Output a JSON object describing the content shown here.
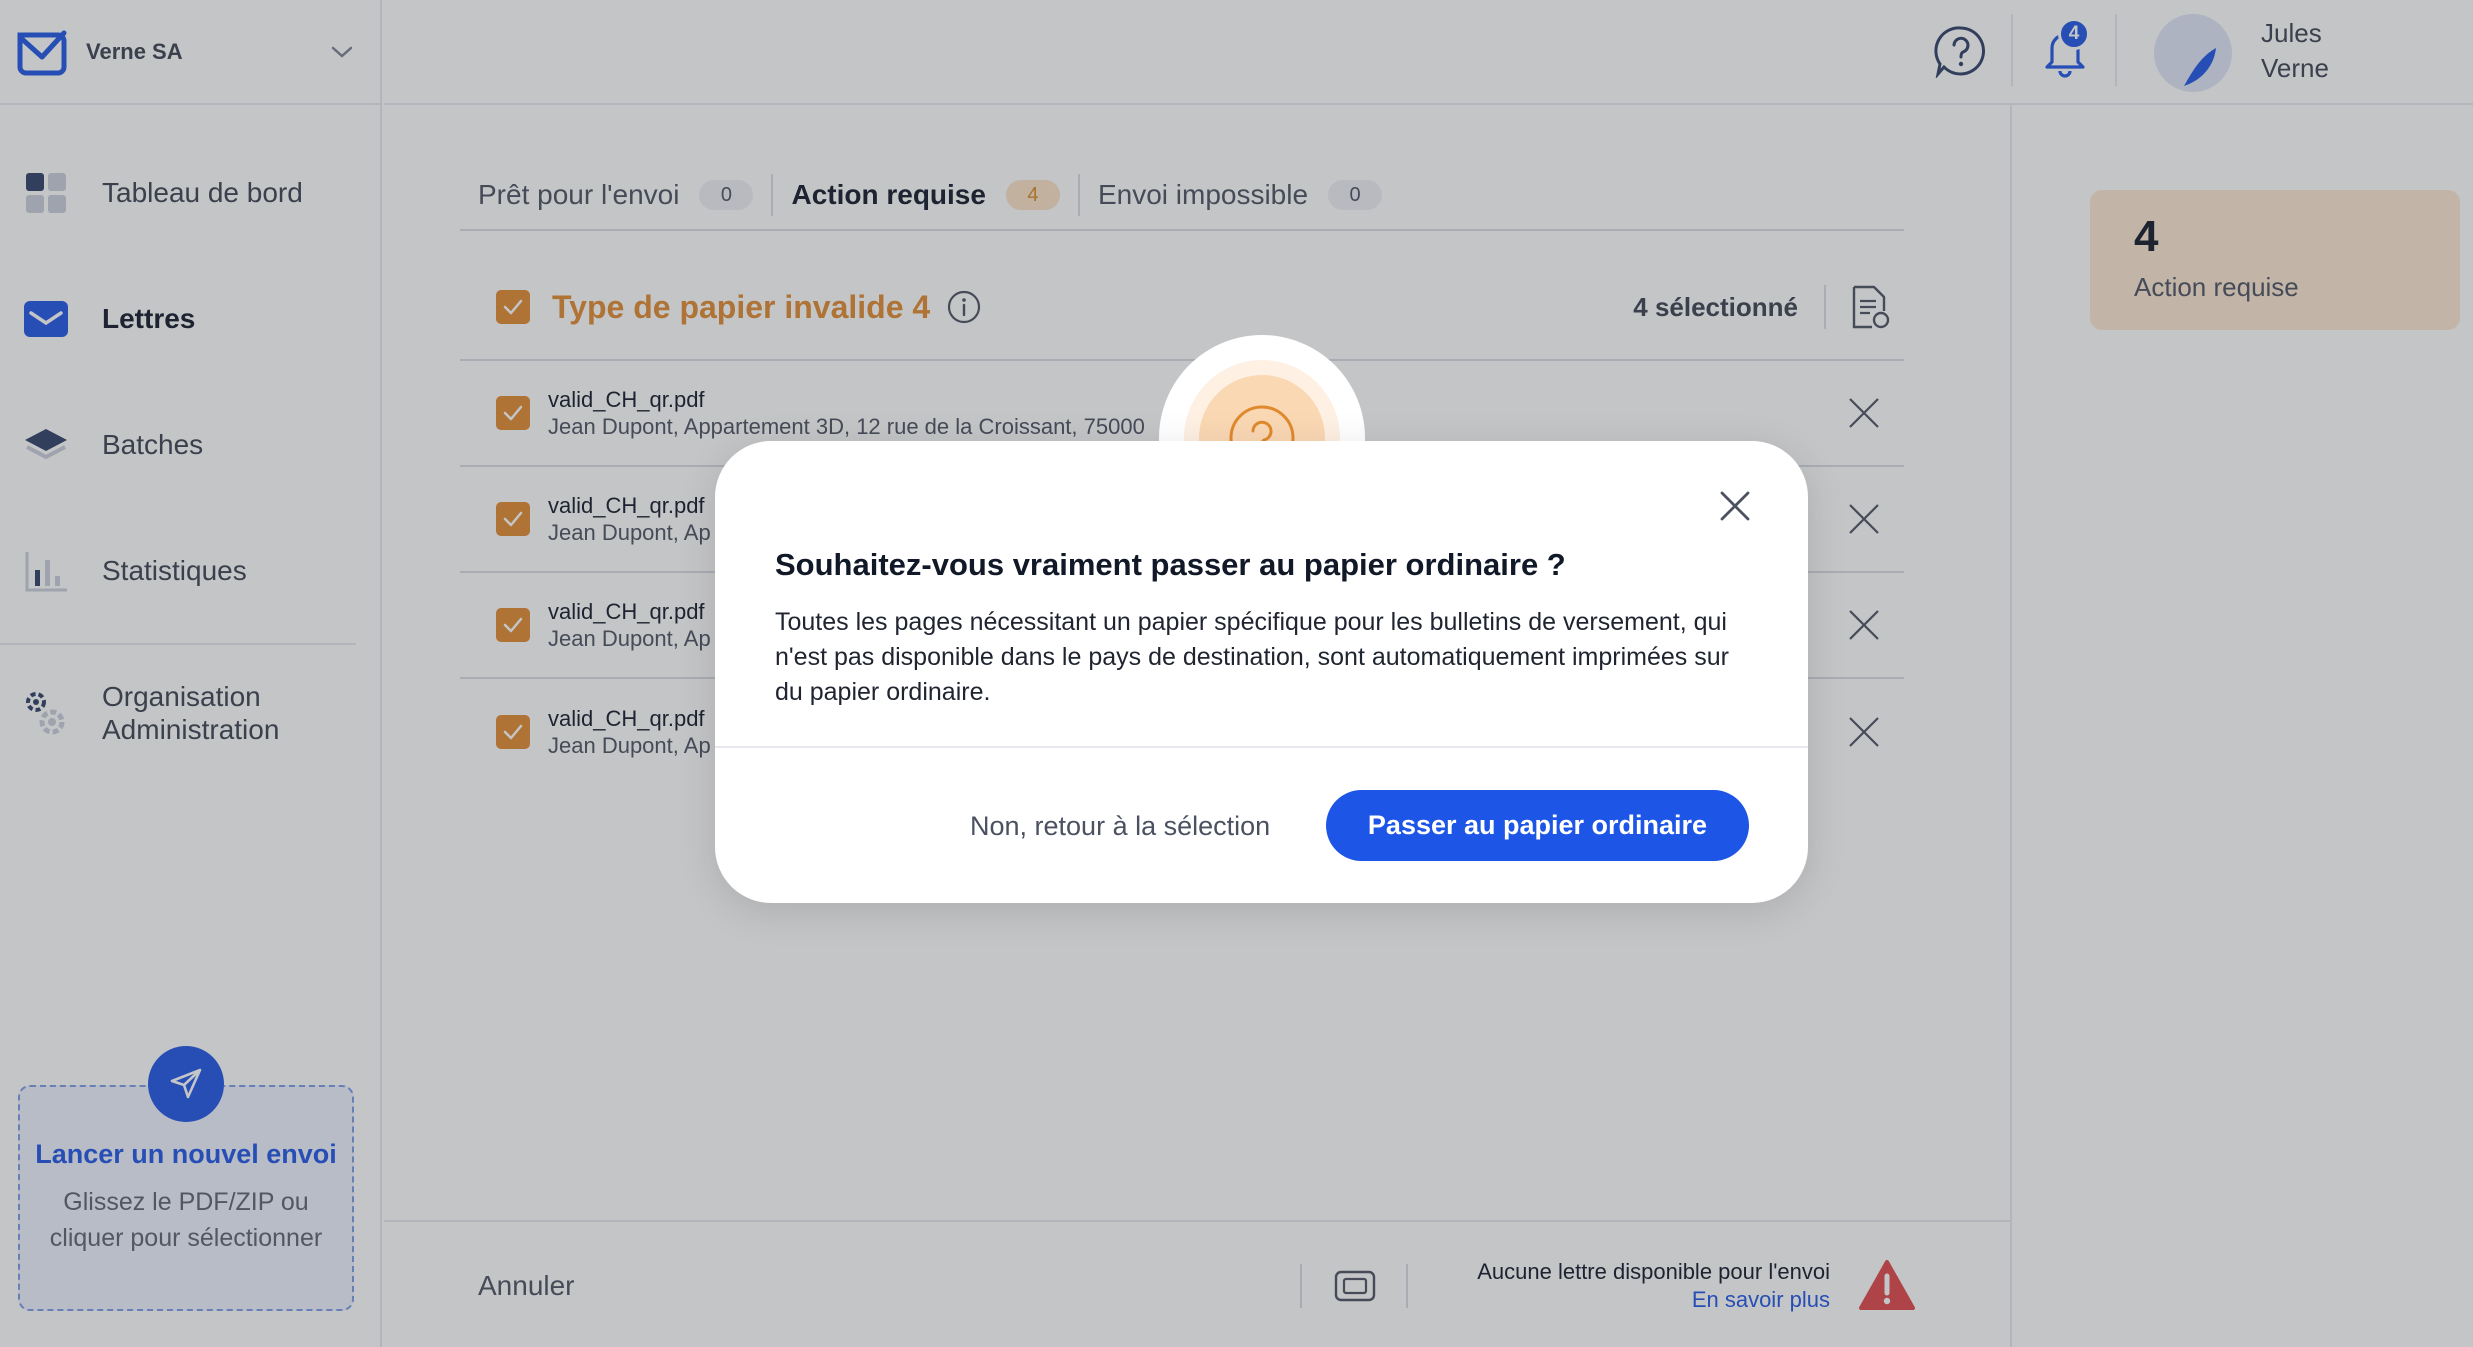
{
  "sidebar": {
    "org_name": "Verne SA",
    "nav": [
      {
        "label": "Tableau de bord",
        "icon": "dashboard-icon"
      },
      {
        "label": "Lettres",
        "icon": "mail-icon",
        "active": true
      },
      {
        "label": "Batches",
        "icon": "layers-icon"
      },
      {
        "label": "Statistiques",
        "icon": "bar-chart-icon"
      }
    ],
    "admin": {
      "line1": "Organisation",
      "line2": "Administration",
      "icon": "gear-icon"
    },
    "upload": {
      "title": "Lancer un nouvel envoi",
      "subtitle": "Glissez le PDF/ZIP ou cliquer pour sélectionner",
      "icon": "send-icon"
    }
  },
  "header": {
    "notifications_count": "4",
    "user_first": "Jules",
    "user_last": "Verne"
  },
  "main": {
    "tabs": [
      {
        "label": "Prêt pour l'envoi",
        "count": "0"
      },
      {
        "label": "Action requise",
        "count": "4",
        "active": true
      },
      {
        "label": "Envoi impossible",
        "count": "0"
      }
    ],
    "group": {
      "title": "Type de papier invalide",
      "count": "4",
      "selected": "4 sélectionné"
    },
    "letters": [
      {
        "file": "valid_CH_qr.pdf",
        "address": "Jean Dupont, Appartement 3D, 12 rue de la Croissant, 75000"
      },
      {
        "file": "valid_CH_qr.pdf",
        "address": "Jean Dupont, Ap"
      },
      {
        "file": "valid_CH_qr.pdf",
        "address": "Jean Dupont, Ap"
      },
      {
        "file": "valid_CH_qr.pdf",
        "address": "Jean Dupont, Ap"
      }
    ]
  },
  "right_panel": {
    "count": "4",
    "label": "Action requise"
  },
  "bottom_bar": {
    "cancel": "Annuler",
    "status": "Aucune lettre disponible pour l'envoi",
    "link": "En savoir plus"
  },
  "modal": {
    "title": "Souhaitez-vous vraiment passer au papier ordinaire ?",
    "body": "Toutes les pages nécessitant un papier spécifique pour les bulletins de versement, qui n'est pas disponible dans le pays de destination, sont automatiquement imprimées sur du papier ordinaire.",
    "secondary": "Non, retour à la sélection",
    "primary": "Passer au papier ordinaire"
  },
  "colors": {
    "brand": "#1d55e6",
    "warning": "#e08a2e",
    "warning_soft": "#fde8d2",
    "danger": "#e0454a"
  }
}
